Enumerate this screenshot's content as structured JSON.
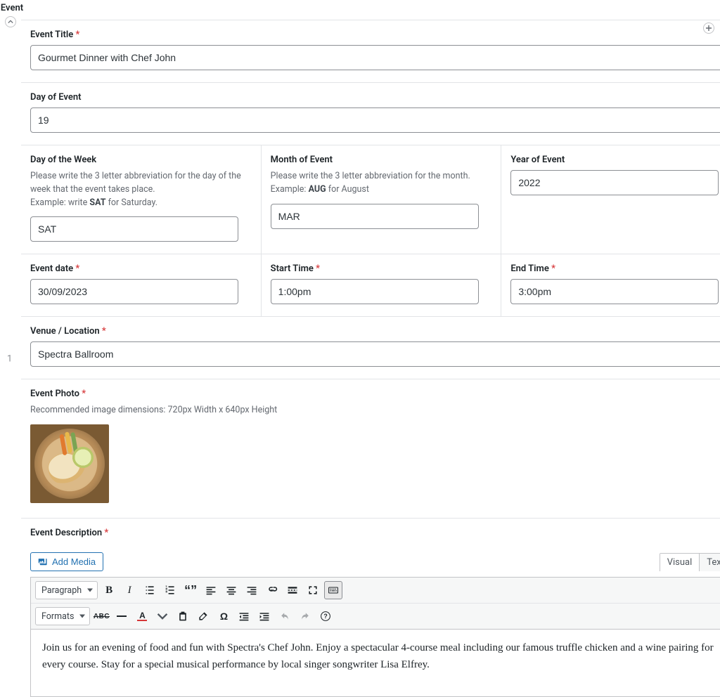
{
  "section_title": "Event",
  "row_index": "1",
  "title": {
    "label": "Event Title",
    "value": "Gourmet Dinner with Chef John"
  },
  "day_of_event": {
    "label": "Day of Event",
    "value": "19"
  },
  "day_of_week": {
    "label": "Day of the Week",
    "instr_line1": "Please write the 3 letter abbreviation for the day of the week that the event takes place.",
    "instr_prefix": "Example: write ",
    "instr_bold": "SAT",
    "instr_suffix": " for Saturday.",
    "value": "SAT"
  },
  "month": {
    "label": "Month of Event",
    "instr_line1": "Please write the 3 letter abbreviation for the month.",
    "instr_prefix": "Example: ",
    "instr_bold": "AUG",
    "instr_suffix": " for August",
    "value": "MAR"
  },
  "year": {
    "label": "Year of Event",
    "value": "2022"
  },
  "event_date": {
    "label": "Event date",
    "value": "30/09/2023"
  },
  "start_time": {
    "label": "Start Time",
    "value": "1:00pm"
  },
  "end_time": {
    "label": "End Time",
    "value": "3:00pm"
  },
  "venue": {
    "label": "Venue / Location",
    "value": "Spectra Ballroom"
  },
  "photo": {
    "label": "Event Photo",
    "instr": "Recommended image dimensions: 720px Width x 640px Height"
  },
  "description": {
    "label": "Event Description",
    "add_media": "Add Media",
    "tabs": {
      "visual": "Visual",
      "text": "Text"
    },
    "paragraph_select": "Paragraph",
    "formats_select": "Formats",
    "body": "Join us for an evening of food and fun with Spectra's Chef John. Enjoy a spectacular 4-course meal including our famous truffle chicken and a wine pairing for every course. Stay for a special musical performance by local singer songwriter Lisa Elfrey."
  }
}
